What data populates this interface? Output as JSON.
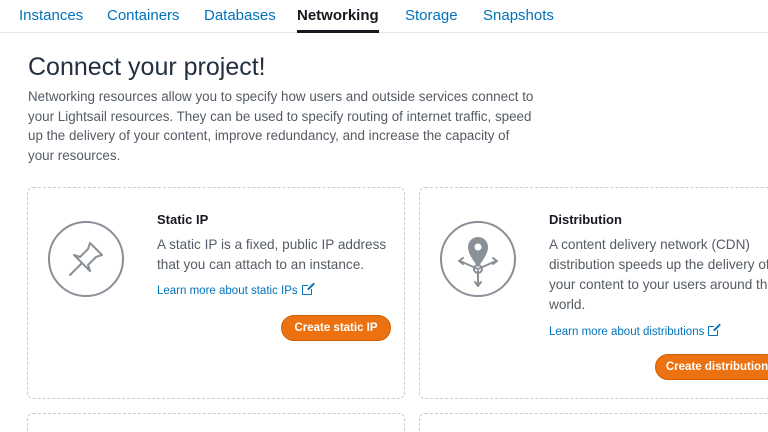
{
  "tabs": [
    {
      "label": "Instances",
      "active": false
    },
    {
      "label": "Containers",
      "active": false
    },
    {
      "label": "Databases",
      "active": false
    },
    {
      "label": "Networking",
      "active": true
    },
    {
      "label": "Storage",
      "active": false
    },
    {
      "label": "Snapshots",
      "active": false
    }
  ],
  "page": {
    "title": "Connect your project!",
    "intro": "Networking resources allow you to specify how users and outside services connect to your Lightsail resources. They can be used to specify routing of internet traffic, speed up the delivery of your content, improve redundancy, and increase the capacity of your resources."
  },
  "cards": {
    "static_ip": {
      "icon": "pushpin-icon",
      "title": "Static IP",
      "description": "A static IP is a fixed, public IP address that you can attach to an instance.",
      "link": "Learn more about static IPs",
      "button": "Create static IP"
    },
    "distribution": {
      "icon": "distribution-pin-icon",
      "title": "Distribution",
      "description": "A content delivery network (CDN) distribution speeds up the delivery of your content to your users around the world.",
      "link": "Learn more about distributions",
      "button": "Create distribution"
    }
  },
  "colors": {
    "link": "#0073bb",
    "primary_button": "#ec7211",
    "icon_stroke": "#8a9097",
    "text_secondary": "#545b64"
  }
}
